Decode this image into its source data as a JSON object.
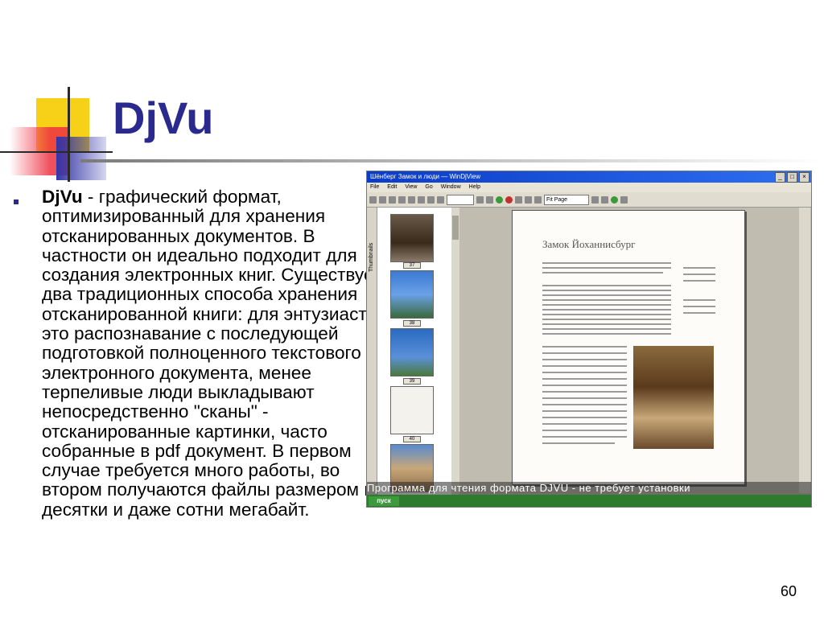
{
  "slide": {
    "title": "DjVu",
    "bullet_term": "DjVu",
    "bullet_text": " - графический формат, оптимизированный для хранения отсканированных документов. В частности он идеально подходит для создания электронных книг. Существует два традиционных способа хранения отсканированной книги: для энтузиастов это распознавание с последующей подготовкой полноценного текстового электронного документа, менее терпеливые люди выкладывают непосредственно \"сканы\" - отсканированные картинки, часто собранные в pdf документ. В первом случае требуется много работы, во втором получаются файлы размером в десятки и даже сотни мегабайт.",
    "page_number": "60",
    "colors": {
      "title": "#2a2a8e",
      "bullet": "#2a2a8e",
      "deco_yellow": "#f7d117",
      "deco_red": "#ee3040",
      "deco_blue": "#3436a8"
    }
  },
  "screenshot": {
    "window_title": "Шёнберг Замок и люди — WinDjView",
    "menu": [
      "File",
      "Edit",
      "View",
      "Go",
      "Window",
      "Help"
    ],
    "page_field": "Fit Page",
    "sidebar_tab_label": "Thumbnails",
    "page_heading": "Замок Йоханнисбург",
    "thumbnail_labels": [
      "37",
      "38",
      "39",
      "40"
    ],
    "caption": "Программа для чтения формата DJVU - не требует установки",
    "start_label": "пуск",
    "icons": [
      "minimize-icon",
      "maximize-icon",
      "close-icon"
    ]
  }
}
